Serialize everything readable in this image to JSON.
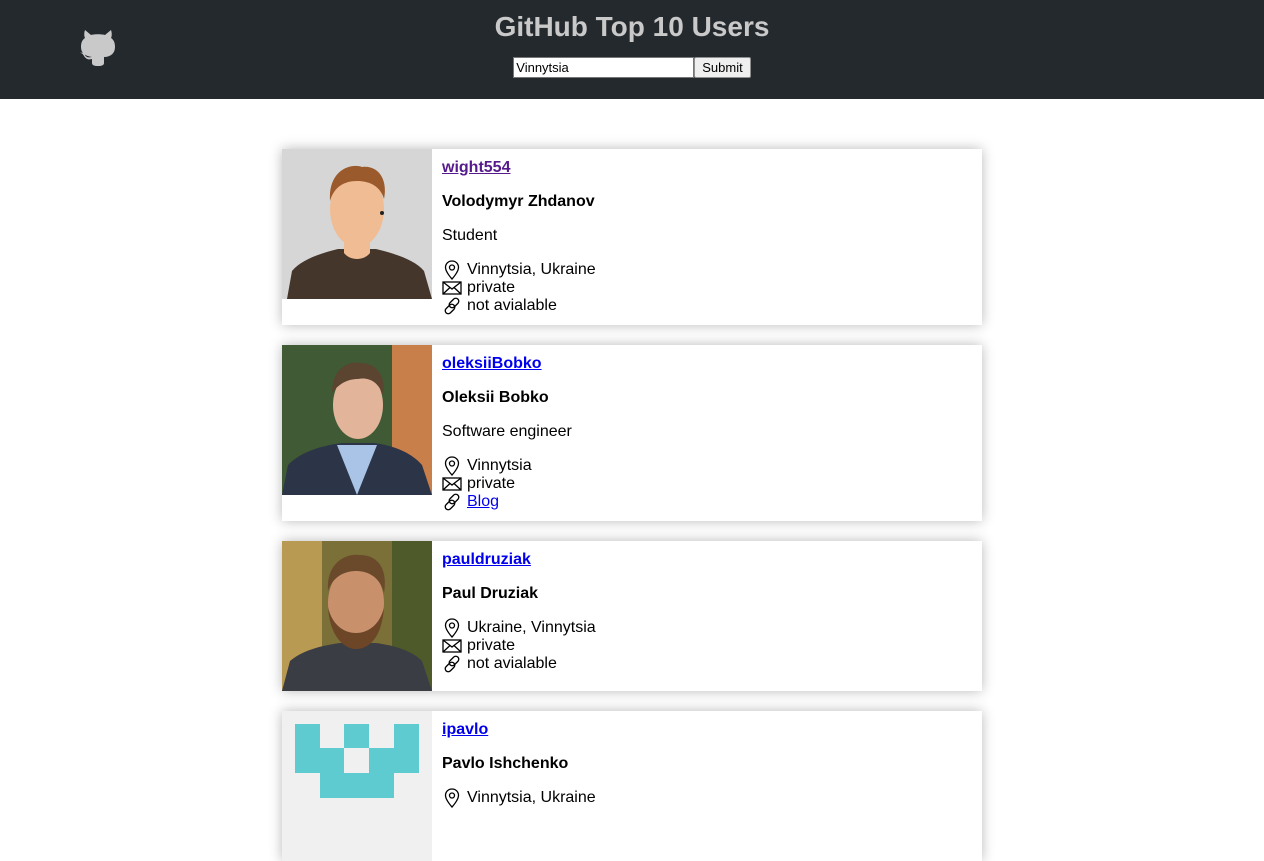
{
  "header": {
    "title": "GitHub Top 10 Users",
    "search_value": "Vinnytsia",
    "submit_label": "Submit"
  },
  "users": [
    {
      "login": "wight554",
      "name": "Volodymyr Zhdanov",
      "bio": "Student",
      "location": "Vinnytsia, Ukraine",
      "email": "private",
      "blog": "not avialable"
    },
    {
      "login": "oleksiiBobko",
      "name": "Oleksii Bobko",
      "bio": "Software engineer",
      "location": "Vinnytsia",
      "email": "private",
      "blog": "Blog"
    },
    {
      "login": "pauldruziak",
      "name": "Paul Druziak",
      "location": "Ukraine, Vinnytsia",
      "email": "private",
      "blog": "not avialable"
    },
    {
      "login": "ipavlo",
      "name": "Pavlo Ishchenko",
      "location": "Vinnytsia, Ukraine"
    }
  ],
  "colors": {
    "header_bg": "#24292e",
    "title": "#c9c9c9",
    "link": "#0000ee",
    "visited_link": "#551a8b",
    "identicon": "#5ecbd0"
  }
}
